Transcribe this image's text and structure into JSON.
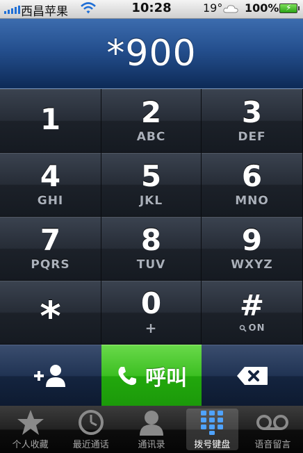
{
  "status_bar": {
    "carrier": "西昌苹果",
    "time": "10:28",
    "temperature": "19°",
    "battery_percent": "100%"
  },
  "dialer": {
    "entered_number": "*900"
  },
  "keypad": {
    "keys": [
      {
        "digit": "1",
        "letters": ""
      },
      {
        "digit": "2",
        "letters": "ABC"
      },
      {
        "digit": "3",
        "letters": "DEF"
      },
      {
        "digit": "4",
        "letters": "GHI"
      },
      {
        "digit": "5",
        "letters": "JKL"
      },
      {
        "digit": "6",
        "letters": "MNO"
      },
      {
        "digit": "7",
        "letters": "PQRS"
      },
      {
        "digit": "8",
        "letters": "TUV"
      },
      {
        "digit": "9",
        "letters": "WXYZ"
      },
      {
        "digit": "*",
        "letters": ""
      },
      {
        "digit": "0",
        "letters": "+"
      },
      {
        "digit": "#",
        "letters": "ON"
      }
    ]
  },
  "actions": {
    "call_label": "呼叫"
  },
  "tabs": [
    {
      "label": "个人收藏",
      "icon": "star-icon"
    },
    {
      "label": "最近通话",
      "icon": "clock-icon"
    },
    {
      "label": "通讯录",
      "icon": "contacts-icon"
    },
    {
      "label": "拨号键盘",
      "icon": "keypad-icon",
      "active": true
    },
    {
      "label": "语音留言",
      "icon": "voicemail-icon"
    }
  ],
  "colors": {
    "display_blue": "#244f8e",
    "call_green": "#3cbf22",
    "status_signal": "#1f6fd6"
  }
}
